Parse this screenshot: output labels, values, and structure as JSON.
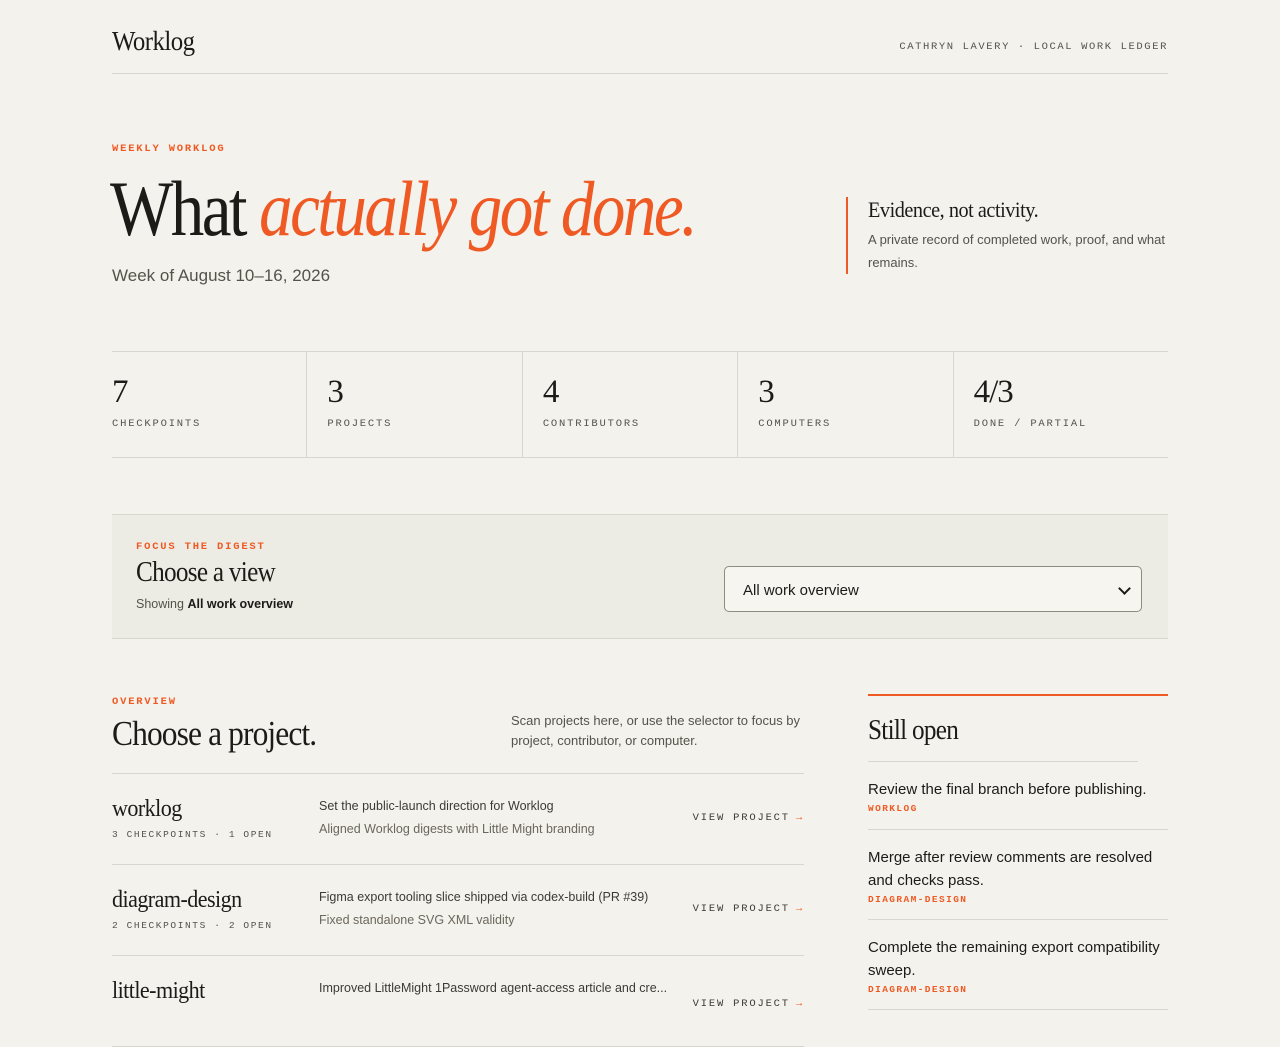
{
  "header": {
    "logo": "Worklog",
    "meta": "CATHRYN LAVERY · LOCAL WORK LEDGER"
  },
  "hero": {
    "eyebrow": "WEEKLY WORKLOG",
    "title_plain": "What",
    "title_emphasis": "actually got done.",
    "week": "Week of August 10–16, 2026",
    "quote_title": "Evidence, not activity.",
    "quote_sub": "A private record of completed work, proof, and what remains."
  },
  "stats": [
    {
      "value": "7",
      "label": "CHECKPOINTS"
    },
    {
      "value": "3",
      "label": "PROJECTS"
    },
    {
      "value": "4",
      "label": "CONTRIBUTORS"
    },
    {
      "value": "3",
      "label": "COMPUTERS"
    },
    {
      "value": "4/3",
      "label": "DONE / PARTIAL"
    }
  ],
  "focus": {
    "eyebrow": "FOCUS THE DIGEST",
    "title": "Choose a view",
    "showing_prefix": "Showing",
    "showing_value": "All work overview",
    "select_value": "All work overview"
  },
  "overview": {
    "eyebrow": "OVERVIEW",
    "title": "Choose a project.",
    "note": "Scan projects here, or use the selector to focus by project, contributor, or computer.",
    "link_label": "VIEW PROJECT",
    "link_arrow": "→",
    "projects": [
      {
        "name": "worklog",
        "meta": "3 CHECKPOINTS · 1 OPEN",
        "line1": "Set the public-launch direction for Worklog",
        "line2": "Aligned Worklog digests with Little Might branding"
      },
      {
        "name": "diagram-design",
        "meta": "2 CHECKPOINTS · 2 OPEN",
        "line1": "Figma export tooling slice shipped via codex-build (PR #39)",
        "line2": "Fixed standalone SVG XML validity"
      },
      {
        "name": "little-might",
        "meta": "",
        "line1": "Improved LittleMight 1Password agent-access article and cre...",
        "line2": ""
      }
    ]
  },
  "still_open": {
    "title": "Still open",
    "items": [
      {
        "text": "Review the final branch before publishing.",
        "tag": "WORKLOG"
      },
      {
        "text": "Merge after review comments are resolved and checks pass.",
        "tag": "DIAGRAM-DESIGN"
      },
      {
        "text": "Complete the remaining export compatibility sweep.",
        "tag": "DIAGRAM-DESIGN"
      }
    ]
  },
  "colors": {
    "accent": "#ef5a24",
    "background": "#f4f2ec",
    "panel": "#ecebe4",
    "text": "#1c1b18"
  }
}
